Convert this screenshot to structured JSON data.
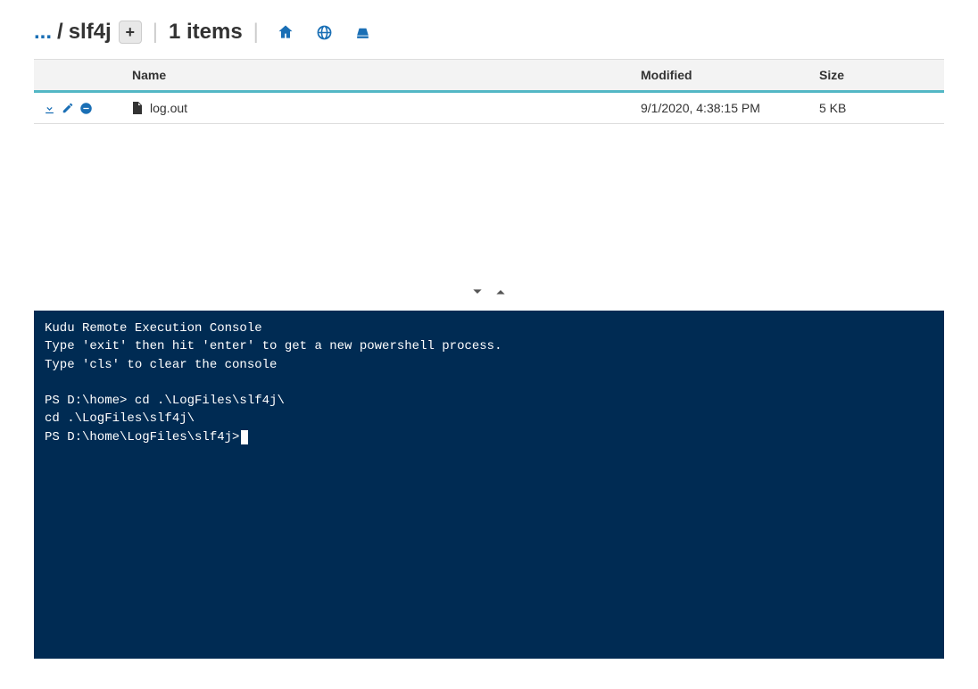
{
  "breadcrumb": {
    "ellipsis": "...",
    "separator": "/",
    "current": "slf4j",
    "add_label": "+"
  },
  "header": {
    "pipe": "|",
    "item_count_text": "1 items"
  },
  "table": {
    "headers": {
      "actions": "",
      "name": "Name",
      "modified": "Modified",
      "size": "Size"
    },
    "rows": [
      {
        "name": "log.out",
        "modified": "9/1/2020, 4:38:15 PM",
        "size": "5 KB"
      }
    ]
  },
  "console": {
    "lines": [
      "Kudu Remote Execution Console",
      "Type 'exit' then hit 'enter' to get a new powershell process.",
      "Type 'cls' to clear the console",
      "",
      "PS D:\\home> cd .\\LogFiles\\slf4j\\",
      "cd .\\LogFiles\\slf4j\\",
      "PS D:\\home\\LogFiles\\slf4j>"
    ]
  }
}
